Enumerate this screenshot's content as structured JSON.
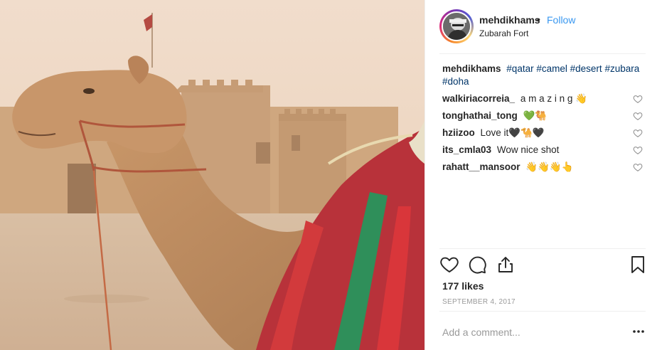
{
  "post": {
    "username": "mehdikhams",
    "separator": "•",
    "follow_label": "Follow",
    "location": "Zubarah Fort",
    "caption": {
      "username": "mehdikhams",
      "hashtags": [
        "#qatar",
        "#camel",
        "#desert",
        "#zubara",
        "#doha"
      ]
    },
    "comments": [
      {
        "username": "walkiriacorreia_",
        "text": "a m a z i n g 👋"
      },
      {
        "username": "tonghathai_tong",
        "text": "💚🐫"
      },
      {
        "username": "hziizoo",
        "text": "Love it🖤🐪🖤"
      },
      {
        "username": "its_cmla03",
        "text": "Wow nice shot"
      },
      {
        "username": "rahatt__mansoor",
        "text": "👋👋👋👆"
      }
    ],
    "likes_label": "177 likes",
    "date": "SEPTEMBER 4, 2017",
    "add_comment_placeholder": "Add a comment...",
    "icons": {
      "like": "heart-icon",
      "comment": "comment-bubble-icon",
      "share": "share-icon",
      "save": "bookmark-icon",
      "more": "more-options-icon"
    },
    "colors": {
      "link": "#3897f0",
      "hashtag": "#003569",
      "muted": "#999999",
      "text": "#262626"
    }
  }
}
